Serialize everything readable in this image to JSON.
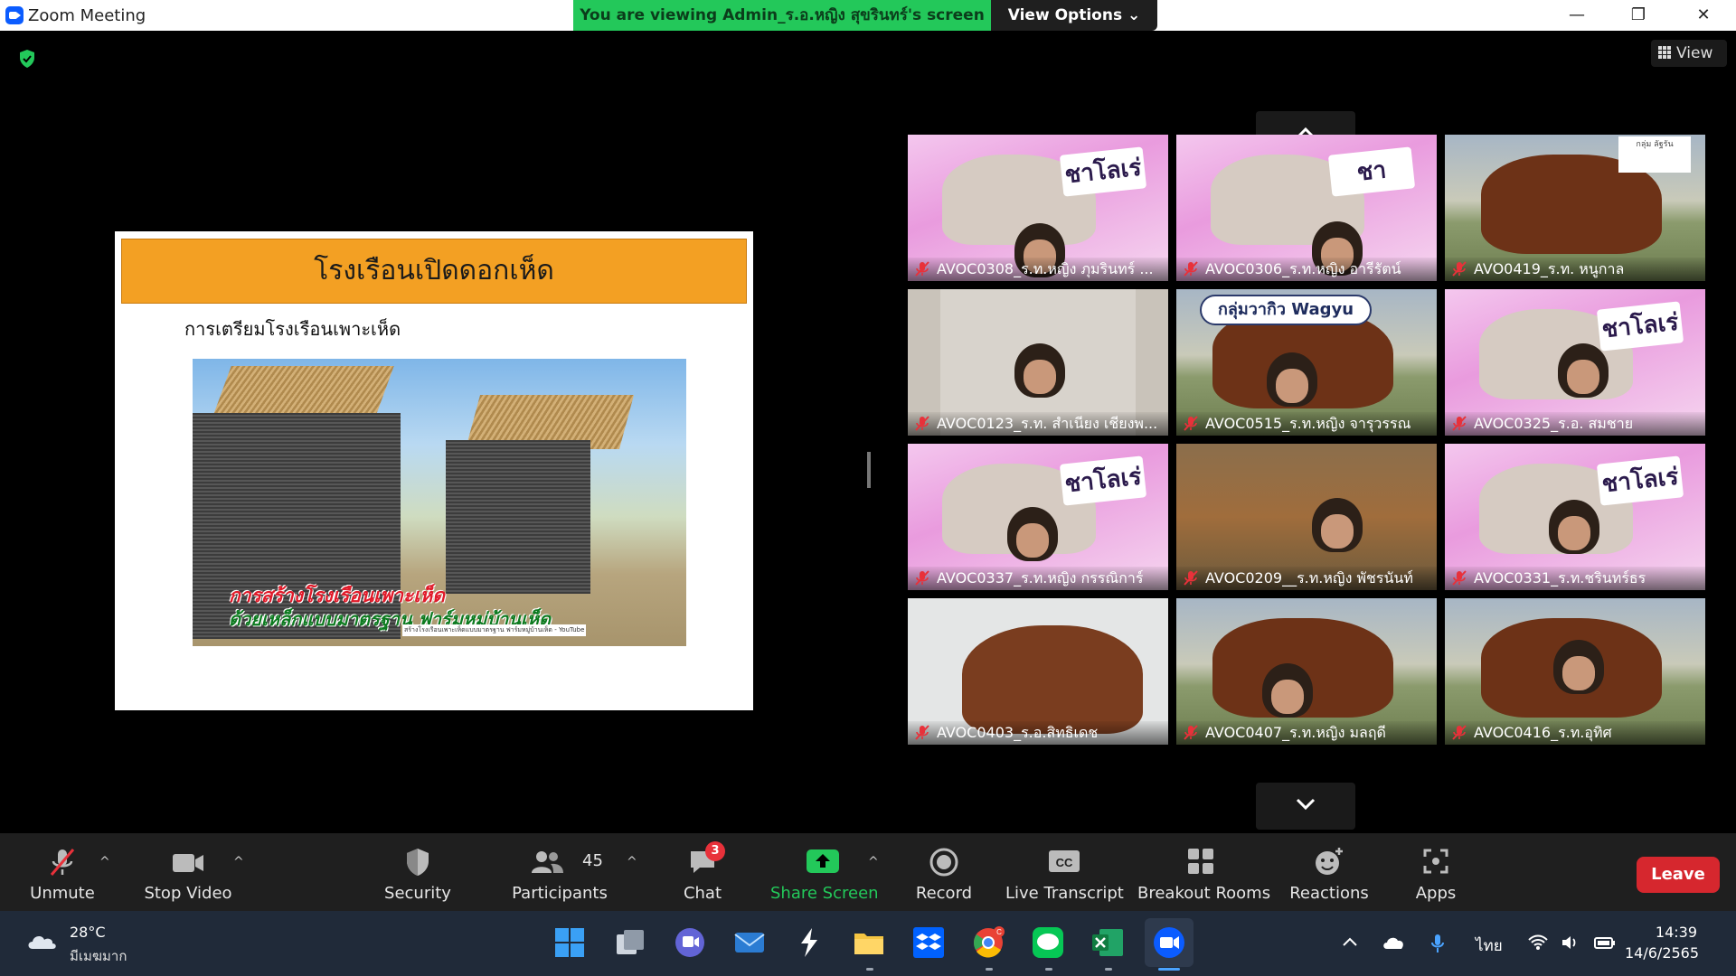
{
  "window": {
    "title": "Zoom Meeting",
    "share_banner": "You are viewing Admin_ร.อ.หญิง สุขรินทร์'s screen",
    "view_options": "View Options ⌄",
    "minimize": "—",
    "restore": "❐",
    "close": "✕"
  },
  "meeting": {
    "view_label": "View"
  },
  "slide": {
    "title": "โรงเรือนเปิดดอกเห็ด",
    "subtitle": "การเตรียมโรงเรือนเพาะเห็ด",
    "photo_caption_line1": "การสร้างโรงเรือนเพาะเห็ด",
    "photo_caption_line2": "ด้วยเหล็กแบบมาตรฐาน ฟาร์มหมู่บ้านเห็ด",
    "photo_credit": "สร้างโรงเรือนเพาะเห็ดแบบมาตรฐาน ฟาร์มหมู่บ้านเห็ด - YouTube"
  },
  "gallery": {
    "participants": [
      {
        "name": "AVOC0308_ร.ท.หญิง ภุมรินทร์ ...",
        "bg": "pink",
        "sign": "ชาโลเร่"
      },
      {
        "name": "AVOC0306_ร.ท.หญิง อารีรัตน์",
        "bg": "pink",
        "sign": "ชา"
      },
      {
        "name": "AVO0419_ร.ท. หนูกาล",
        "bg": "field",
        "sign": "กลุ่ม ลัฐรัน"
      },
      {
        "name": "AVOC0123_ร.ท. สำเนียง เชียงพ...",
        "bg": "room",
        "sign": ""
      },
      {
        "name": "AVOC0515_ร.ท.หญิง จารุวรรณ",
        "bg": "field",
        "sign": "กลุ่มวากิว Wagyu"
      },
      {
        "name": "AVOC0325_ร.อ. สมชาย",
        "bg": "pink",
        "sign": "ชาโลเร่"
      },
      {
        "name": "AVOC0337_ร.ท.หญิง กรรณิการ์",
        "bg": "pink",
        "sign": "ชาโลเร่"
      },
      {
        "name": "AVOC0209__ร.ท.หญิง พัชรนันท์",
        "bg": "brown",
        "sign": ""
      },
      {
        "name": "AVOC0331_ร.ท.ชรินทร์ธร",
        "bg": "pink",
        "sign": "ชาโลเร่"
      },
      {
        "name": "AVOC0403_ร.อ.สิทธิเดช",
        "bg": "wall",
        "sign": ""
      },
      {
        "name": "AVOC0407_ร.ท.หญิง มลฤดี",
        "bg": "field",
        "sign": ""
      },
      {
        "name": "AVOC0416_ร.ท.อุทิศ",
        "bg": "field",
        "sign": ""
      }
    ]
  },
  "toolbar": {
    "unmute": "Unmute",
    "stop_video": "Stop Video",
    "security": "Security",
    "participants": "Participants",
    "participants_count": "45",
    "chat": "Chat",
    "chat_badge": "3",
    "share_screen": "Share Screen",
    "record": "Record",
    "live_transcript": "Live Transcript",
    "breakout_rooms": "Breakout Rooms",
    "reactions": "Reactions",
    "apps": "Apps",
    "leave": "Leave"
  },
  "taskbar": {
    "weather_temp": "28°C",
    "weather_desc": "มีเมฆมาก",
    "language": "ไทย",
    "time": "14:39",
    "date": "14/6/2565",
    "chrome_badge": "C"
  },
  "colors": {
    "share_green": "#23c85a",
    "leave_red": "#d6272e",
    "slide_title_orange": "#f3a023",
    "mute_red": "#e8313a"
  }
}
